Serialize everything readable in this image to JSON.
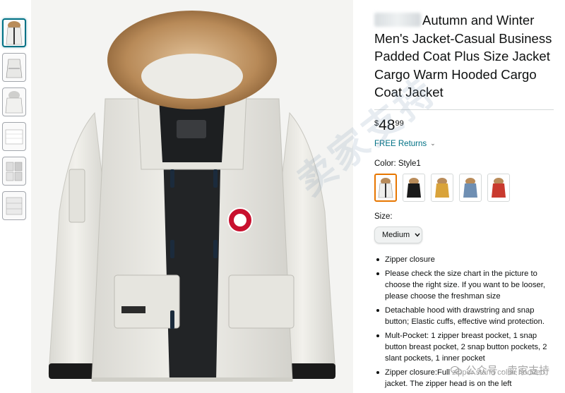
{
  "product": {
    "title": "Autumn and Winter Men's Jacket-Casual Business Padded Coat Plus Size Jacket Cargo Warm Hooded Cargo Coat Jacket",
    "price": {
      "symbol": "$",
      "whole": "48",
      "fraction": "99"
    },
    "returns_label": "FREE Returns",
    "color_label": "Color: Style1",
    "swatch_colors": [
      "#ffffff",
      "#1a1a1a",
      "#d9a33a",
      "#6f8fb3",
      "#c93a2e"
    ],
    "size_label": "Size:",
    "size_value": "Medium",
    "bullets": [
      "Zipper closure",
      "Please check the size chart in the picture to choose the right size. If you want to be looser, please choose the freshman size",
      "Detachable hood with drawstring and snap button; Elastic cuffs, effective wind protection.",
      "Mult-Pocket: 1 zipper breast pocket, 1 snap button breast pocket, 2 snap button pockets, 2 slant pockets, 1 inner pocket",
      "Zipper closure:Full zipper stand collar hooded jacket. The zipper head is on the left"
    ]
  },
  "watermark": {
    "big_text": "卖家支持",
    "footer_text": "公众号 · 卖家支持"
  },
  "colors": {
    "link": "#007185",
    "selected_swatch": "#e77600",
    "thumb_active": "#007185"
  },
  "icons": {
    "share": "share-icon",
    "chevron": "chevron-down-icon"
  }
}
